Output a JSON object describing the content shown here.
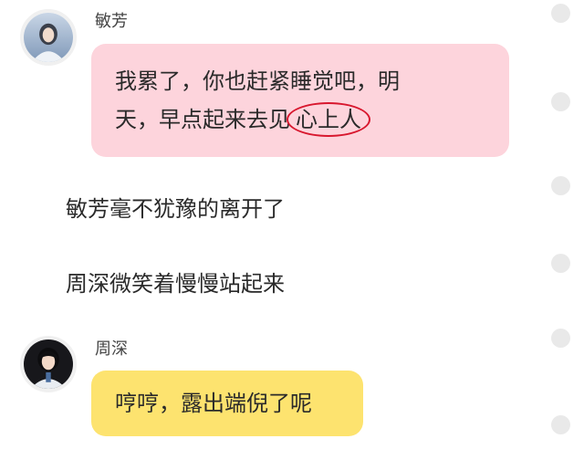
{
  "messages": [
    {
      "speaker": "敏芳",
      "lines": [
        "我累了，你也赶紧睡觉吧，明",
        "天，早点起来去见"
      ],
      "highlighted": "心上人",
      "bubble_color": "#fdd4dc"
    },
    {
      "speaker": "周深",
      "text": "哼哼，露出端倪了呢",
      "bubble_color": "#fde36f"
    }
  ],
  "narration": [
    "敏芳毫不犹豫的离开了",
    "周深微笑着慢慢站起来"
  ],
  "icons": {
    "avatar_1": "avatar-minfang-icon",
    "avatar_2": "avatar-zhoushen-icon",
    "select_dot": "select-dot-icon",
    "circle_annotation": "red-circle-annotation"
  },
  "colors": {
    "pink_bubble": "#fdd4dc",
    "yellow_bubble": "#fde36f",
    "circle_annotation": "#d8172e"
  }
}
